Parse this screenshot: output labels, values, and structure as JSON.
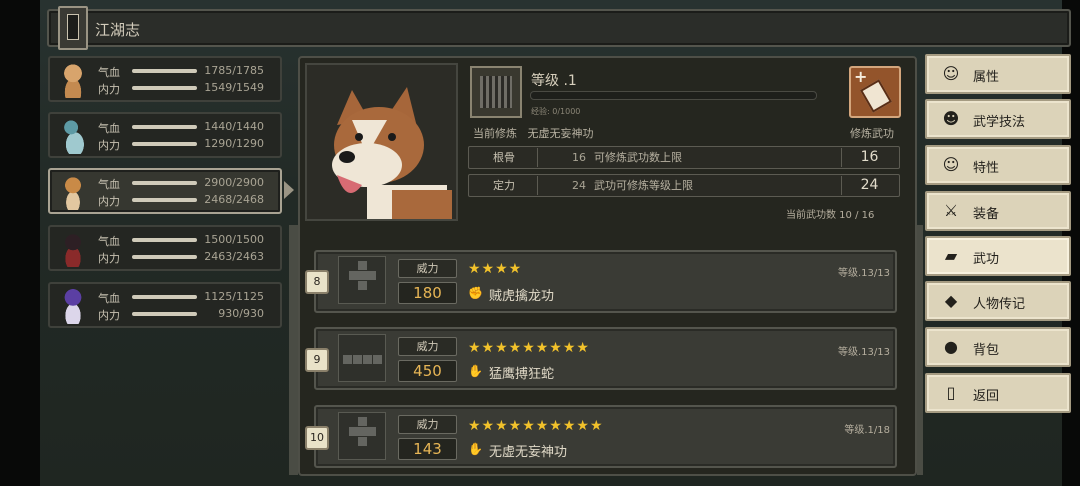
{
  "title": "江湖志",
  "party": [
    {
      "hp_label": "气血",
      "hp": "1785/1785",
      "mp_label": "内力",
      "mp": "1549/1549"
    },
    {
      "hp_label": "气血",
      "hp": "1440/1440",
      "mp_label": "内力",
      "mp": "1290/1290"
    },
    {
      "hp_label": "气血",
      "hp": "2900/2900",
      "mp_label": "内力",
      "mp": "2468/2468"
    },
    {
      "hp_label": "气血",
      "hp": "1500/1500",
      "mp_label": "内力",
      "mp": "2463/2463"
    },
    {
      "hp_label": "气血",
      "hp": "1125/1125",
      "mp_label": "内力",
      "mp": "930/930"
    }
  ],
  "info": {
    "level": "等级 .1",
    "xp": "经验: 0/1000",
    "current_label": "当前修炼",
    "current_name": "无虚无妄神功",
    "train_label": "修炼武功",
    "stats": [
      {
        "name": "根骨",
        "value": "16",
        "desc": "可修炼武功数上限",
        "big": "16"
      },
      {
        "name": "定力",
        "value": "24",
        "desc": "武功可修炼等级上限",
        "big": "24"
      }
    ],
    "count": "当前武功数   10 / 16"
  },
  "skills": [
    {
      "index": "8",
      "power_label": "威力",
      "power": "180",
      "stars": "★★★★",
      "level": "等级.13/13",
      "name": "贼虎擒龙功"
    },
    {
      "index": "9",
      "power_label": "威力",
      "power": "450",
      "stars": "★★★★★★★★★",
      "level": "等级.13/13",
      "name": "猛鹰搏狂蛇"
    },
    {
      "index": "10",
      "power_label": "威力",
      "power": "143",
      "stars": "★★★★★★★★★★",
      "level": "等级.1/18",
      "name": "无虚无妄神功"
    }
  ],
  "menu": [
    {
      "label": "属性",
      "icon": "person-icon"
    },
    {
      "label": "武学技法",
      "icon": "person-spark-icon"
    },
    {
      "label": "特性",
      "icon": "person-gear-icon"
    },
    {
      "label": "装备",
      "icon": "sword-icon"
    },
    {
      "label": "武功",
      "icon": "book-icon"
    },
    {
      "label": "人物传记",
      "icon": "scroll-icon"
    },
    {
      "label": "背包",
      "icon": "bag-icon"
    },
    {
      "label": "返回",
      "icon": "door-icon"
    }
  ]
}
